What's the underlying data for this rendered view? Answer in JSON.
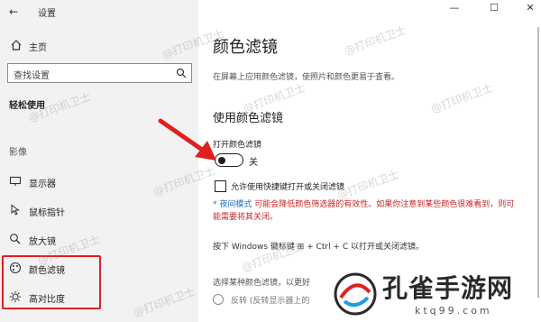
{
  "app": {
    "title": "设置"
  },
  "window": {
    "minimize_icon": "minimize-icon",
    "maximize_icon": "maximize-icon",
    "close_icon": "close-icon"
  },
  "sidebar": {
    "home_label": "主页",
    "search_placeholder": "查找设置",
    "section_label": "轻松使用",
    "subsection_label": "影像",
    "items": [
      {
        "label": "显示器",
        "icon": "monitor-icon"
      },
      {
        "label": "鼠标指针",
        "icon": "mouse-pointer-icon"
      },
      {
        "label": "放大镜",
        "icon": "magnifier-icon"
      },
      {
        "label": "颜色滤镜",
        "icon": "color-filter-icon"
      },
      {
        "label": "高对比度",
        "icon": "high-contrast-icon"
      }
    ]
  },
  "main": {
    "title": "颜色滤镜",
    "description": "在屏幕上应用颜色滤镜，使照片和颜色更易于查看。",
    "subheading": "使用颜色滤镜",
    "toggle_label": "打开颜色滤镜",
    "toggle_state": "关",
    "checkbox_label": "允许使用快捷键打开或关闭滤镜",
    "note_link": "* 夜间模式",
    "note_text": " 可能会降低颜色筛选器的有效性。如果你注意到某些颜色很难看到，则可能需要将其关闭。",
    "shortcut_text": "按下 Windows 徽标键 ⊞ + Ctrl + C 以打开或关闭滤镜。",
    "select_label": "选择某种颜色滤镜，以更好",
    "radio_label": "反转 (反转显示器上的"
  },
  "watermark": {
    "text": "@打印机卫士"
  },
  "logo": {
    "text": "孔雀手游网",
    "sub": "ktq99.com"
  },
  "colors": {
    "accent": "#1f6fc1",
    "annotation": "#e02020",
    "warning": "#c62828"
  }
}
